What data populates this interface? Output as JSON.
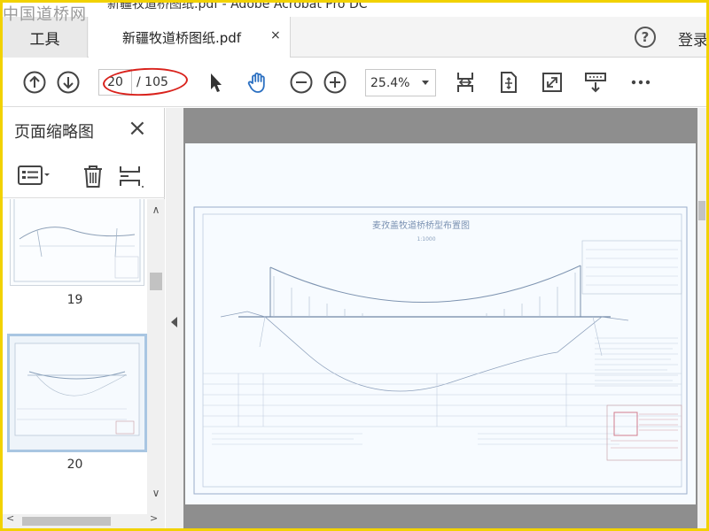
{
  "watermark": "中国道桥网",
  "window": {
    "title_partial": "新疆牧道桥图纸.pdf - Adobe Acrobat Pro DC"
  },
  "tabs": {
    "tools_label": "工具",
    "doc_label": "新疆牧道桥图纸.pdf",
    "close_symbol": "×"
  },
  "header": {
    "login_label": "登录",
    "help_symbol": "?"
  },
  "toolbar": {
    "current_page": "20",
    "total_pages": "/ 105",
    "zoom": "25.4%"
  },
  "sidepanel": {
    "title": "页面缩略图",
    "close_symbol": "×",
    "thumbnails": [
      {
        "page": "19",
        "selected": false
      },
      {
        "page": "20",
        "selected": true
      }
    ]
  },
  "drawing": {
    "title": "麦孜盖牧道桥桥型布置图",
    "scale": "1:1000"
  },
  "colors": {
    "accent": "#2a6fc1",
    "annotation": "#d9221c",
    "frame": "#f2d200"
  }
}
